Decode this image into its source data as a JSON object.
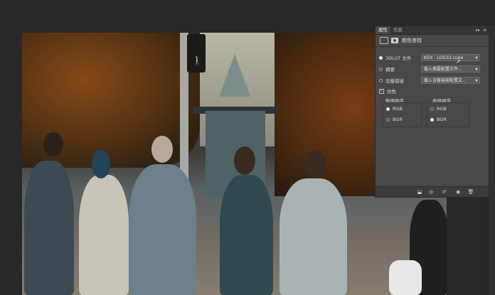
{
  "panel": {
    "tabs": [
      "属性",
      "信息"
    ],
    "header_buttons": {
      "collapse": "▸▸",
      "menu": "≡"
    },
    "adjustment_title": "颜色查找",
    "options": [
      {
        "label": "3DLUT 文件",
        "value": "KDX - LOG32.cube",
        "selected": true
      },
      {
        "label": "摘要",
        "value": "载入摘要配置文件...",
        "selected": false
      },
      {
        "label": "设备链接",
        "value": "载入设备链接配置文...",
        "selected": false
      }
    ],
    "dither": {
      "label": "仿色",
      "checked": true
    },
    "data_order": {
      "title": "数据顺序",
      "options": [
        "RGB",
        "BGR"
      ],
      "selected": "RGB"
    },
    "table_order": {
      "title": "表格顺序",
      "options": [
        "RGB",
        "BGR"
      ],
      "selected": "BGR"
    }
  },
  "icons": {
    "adjustment_layer": "adjustment-layer-icon",
    "mask": "mask-icon",
    "clip": "clip-to-layer-icon",
    "view_previous": "view-previous-icon",
    "reset": "reset-icon",
    "visibility": "visibility-icon",
    "delete": "trash-icon"
  },
  "colors": {
    "panel_bg": "#484848",
    "panel_header": "#353535",
    "workspace": "#282828"
  }
}
